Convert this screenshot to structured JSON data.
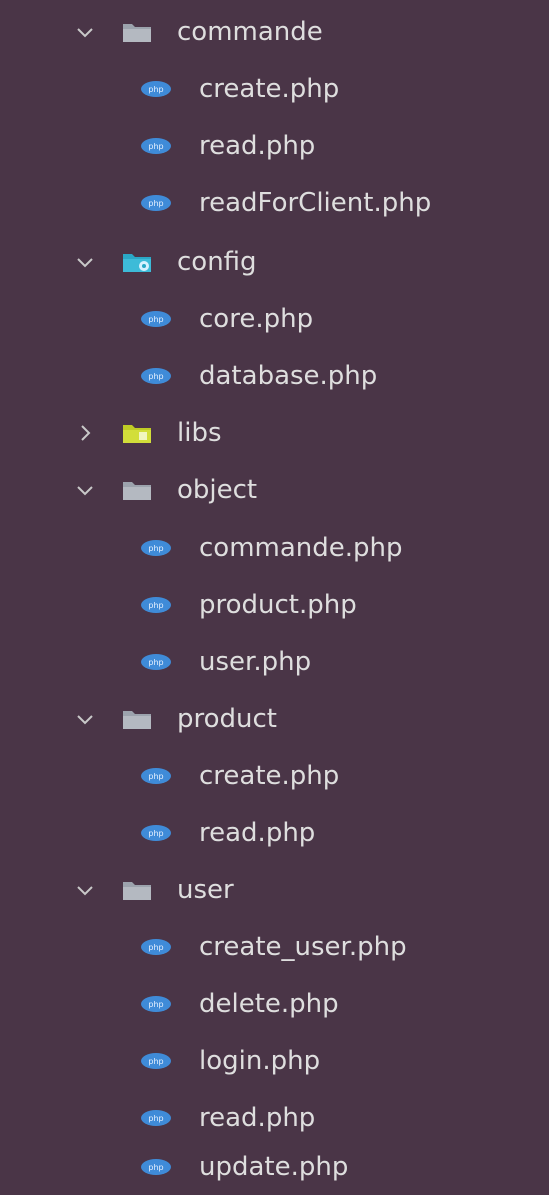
{
  "tree": {
    "items": [
      {
        "label": "commande",
        "type": "folder",
        "expanded": true,
        "icon": "folder-icon",
        "level": 0
      },
      {
        "label": "create.php",
        "type": "file",
        "icon": "php-file-icon",
        "level": 1
      },
      {
        "label": "read.php",
        "type": "file",
        "icon": "php-file-icon",
        "level": 1
      },
      {
        "label": "readForClient.php",
        "type": "file",
        "icon": "php-file-icon",
        "level": 1
      },
      {
        "label": "config",
        "type": "folder",
        "expanded": true,
        "icon": "config-folder-icon",
        "level": 0
      },
      {
        "label": "core.php",
        "type": "file",
        "icon": "php-file-icon",
        "level": 1
      },
      {
        "label": "database.php",
        "type": "file",
        "icon": "php-file-icon",
        "level": 1
      },
      {
        "label": "libs",
        "type": "folder",
        "expanded": false,
        "icon": "libs-folder-icon",
        "level": 0
      },
      {
        "label": "object",
        "type": "folder",
        "expanded": true,
        "icon": "folder-icon",
        "level": 0
      },
      {
        "label": "commande.php",
        "type": "file",
        "icon": "php-file-icon",
        "level": 1
      },
      {
        "label": "product.php",
        "type": "file",
        "icon": "php-file-icon",
        "level": 1
      },
      {
        "label": "user.php",
        "type": "file",
        "icon": "php-file-icon",
        "level": 1
      },
      {
        "label": "product",
        "type": "folder",
        "expanded": true,
        "icon": "folder-icon",
        "level": 0
      },
      {
        "label": "create.php",
        "type": "file",
        "icon": "php-file-icon",
        "level": 1
      },
      {
        "label": "read.php",
        "type": "file",
        "icon": "php-file-icon",
        "level": 1
      },
      {
        "label": "user",
        "type": "folder",
        "expanded": true,
        "icon": "folder-icon",
        "level": 0
      },
      {
        "label": "create_user.php",
        "type": "file",
        "icon": "php-file-icon",
        "level": 1
      },
      {
        "label": "delete.php",
        "type": "file",
        "icon": "php-file-icon",
        "level": 1
      },
      {
        "label": "login.php",
        "type": "file",
        "icon": "php-file-icon",
        "level": 1
      },
      {
        "label": "read.php",
        "type": "file",
        "icon": "php-file-icon",
        "level": 1
      },
      {
        "label": "update.php",
        "type": "file",
        "icon": "php-file-icon",
        "level": 1
      }
    ]
  },
  "colors": {
    "background": "#4a3547",
    "text": "#dedede",
    "chevron": "#c9c9c9",
    "folder": "#9ca3ad",
    "config_folder": "#2aa8c6",
    "libs_folder": "#c5d22a",
    "php_icon": "#3f8bd8"
  }
}
